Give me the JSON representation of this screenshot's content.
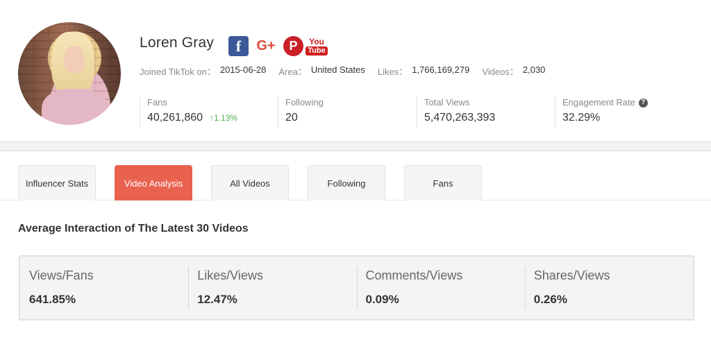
{
  "profile": {
    "name": "Loren Gray",
    "socials": [
      {
        "name": "facebook-icon",
        "glyph": "f"
      },
      {
        "name": "google-plus-icon",
        "glyph": "G+"
      },
      {
        "name": "pinterest-icon",
        "glyph": "P"
      },
      {
        "name": "youtube-icon",
        "glyph1": "You",
        "glyph2": "Tube"
      }
    ],
    "joined_label": "Joined TikTok on：",
    "joined_value": "2015-06-28",
    "area_label": "Area：",
    "area_value": "United States",
    "likes_label": "Likes：",
    "likes_value": "1,766,169,279",
    "videos_label": "Videos：",
    "videos_value": "2,030"
  },
  "stats": {
    "fans": {
      "label": "Fans",
      "value": "40,261,860",
      "growth": "1.13%"
    },
    "following": {
      "label": "Following",
      "value": "20"
    },
    "total_views": {
      "label": "Total Views",
      "value": "5,470,263,393"
    },
    "engagement": {
      "label": "Engagement Rate",
      "value": "32.29%",
      "help": "?"
    }
  },
  "tabs": [
    {
      "label": "Influencer Stats",
      "active": false
    },
    {
      "label": "Video Analysis",
      "active": true
    },
    {
      "label": "All Videos",
      "active": false
    },
    {
      "label": "Following",
      "active": false
    },
    {
      "label": "Fans",
      "active": false
    }
  ],
  "section": {
    "title": "Average Interaction of The Latest 30 Videos",
    "metrics": [
      {
        "label": "Views/Fans",
        "value": "641.85%"
      },
      {
        "label": "Likes/Views",
        "value": "12.47%"
      },
      {
        "label": "Comments/Views",
        "value": "0.09%"
      },
      {
        "label": "Shares/Views",
        "value": "0.26%"
      }
    ]
  },
  "colors": {
    "accent": "#e9624f",
    "growth": "#4caf50",
    "facebook": "#3b5998",
    "google_plus": "#dd4b39",
    "pinterest": "#cb2027",
    "youtube": "#cd201f"
  }
}
